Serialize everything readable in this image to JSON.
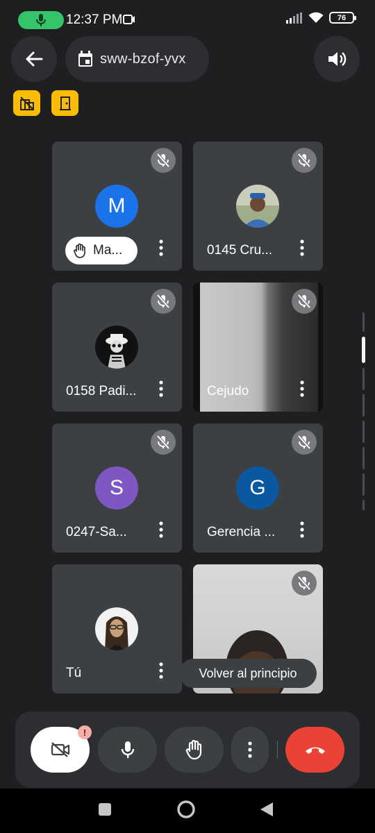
{
  "status_bar": {
    "time": "12:37 PM",
    "battery": "76",
    "icons": [
      "mic-recording-icon",
      "screen-record-icon",
      "signal-icon",
      "wifi-icon",
      "battery-icon"
    ]
  },
  "header": {
    "meeting_code": "sww-bzof-yvx",
    "icons": [
      "back-arrow-icon",
      "calendar-icon",
      "speaker-icon",
      "host-controls-icon",
      "breakout-door-icon"
    ]
  },
  "participants": [
    {
      "name": "Ma...",
      "avatar_letter": "M",
      "avatar_color": "#1a73e8",
      "hand_raised": true
    },
    {
      "name": "0145 Cru...",
      "avatar_type": "photo"
    },
    {
      "name": "0158 Padi...",
      "avatar_type": "photo"
    },
    {
      "name": "Cejudo",
      "avatar_type": "video"
    },
    {
      "name": "0247-Sa...",
      "avatar_letter": "S",
      "avatar_color": "#7e57c2"
    },
    {
      "name": "Gerencia ...",
      "avatar_letter": "G",
      "avatar_color": "#0b57a0"
    },
    {
      "name": "Tú",
      "avatar_type": "photo"
    },
    {
      "name": "",
      "avatar_type": "video"
    }
  ],
  "scroll_to_top": "Volver al principio",
  "colors": {
    "accent_yellow": "#fbbc04",
    "end_call_red": "#ea4335",
    "mic_active_green": "#35c46a"
  }
}
